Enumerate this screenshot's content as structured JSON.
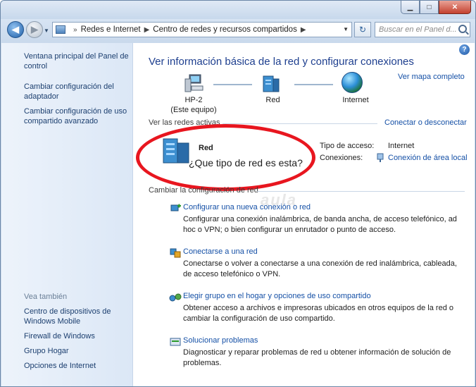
{
  "address": {
    "crumbs": [
      "Redes e Internet",
      "Centro de redes y recursos compartidos"
    ],
    "search_placeholder": "Buscar en el Panel d..."
  },
  "sidebar": {
    "links": [
      "Ventana principal del Panel de control",
      "Cambiar configuración del adaptador",
      "Cambiar configuración de uso compartido avanzado"
    ],
    "see_also_heading": "Vea también",
    "see_also": [
      "Centro de dispositivos de Windows Mobile",
      "Firewall de Windows",
      "Grupo Hogar",
      "Opciones de Internet"
    ]
  },
  "main": {
    "title": "Ver información básica de la red y configurar conexiones",
    "full_map": "Ver mapa completo",
    "map": {
      "pc_name": "HP-2",
      "pc_sub": "(Este equipo)",
      "network": "Red",
      "internet": "Internet"
    },
    "active_heading": "Ver las redes activas",
    "connect_link": "Conectar o desconectar",
    "active": {
      "name": "Red",
      "question": "¿Que tipo de red es esta?",
      "access_label": "Tipo de acceso:",
      "access_value": "Internet",
      "conn_label": "Conexiones:",
      "conn_value": "Conexión de área local"
    },
    "change_heading": "Cambiar la configuración de red",
    "tasks": [
      {
        "title": "Configurar una nueva conexión o red",
        "desc": "Configurar una conexión inalámbrica, de banda ancha, de acceso telefónico, ad hoc o VPN; o bien configurar un enrutador o punto de acceso."
      },
      {
        "title": "Conectarse a una red",
        "desc": "Conectarse o volver a conectarse a una conexión de red inalámbrica, cableada, de acceso telefónico o VPN."
      },
      {
        "title": "Elegir grupo en el hogar y opciones de uso compartido",
        "desc": "Obtener acceso a archivos e impresoras ubicados en otros equipos de la red o cambiar la configuración de uso compartido."
      },
      {
        "title": "Solucionar problemas",
        "desc": "Diagnosticar y reparar problemas de red u obtener información de solución de problemas."
      }
    ]
  },
  "colors": {
    "accent": "#1550a6",
    "annotation": "#e8161f"
  }
}
